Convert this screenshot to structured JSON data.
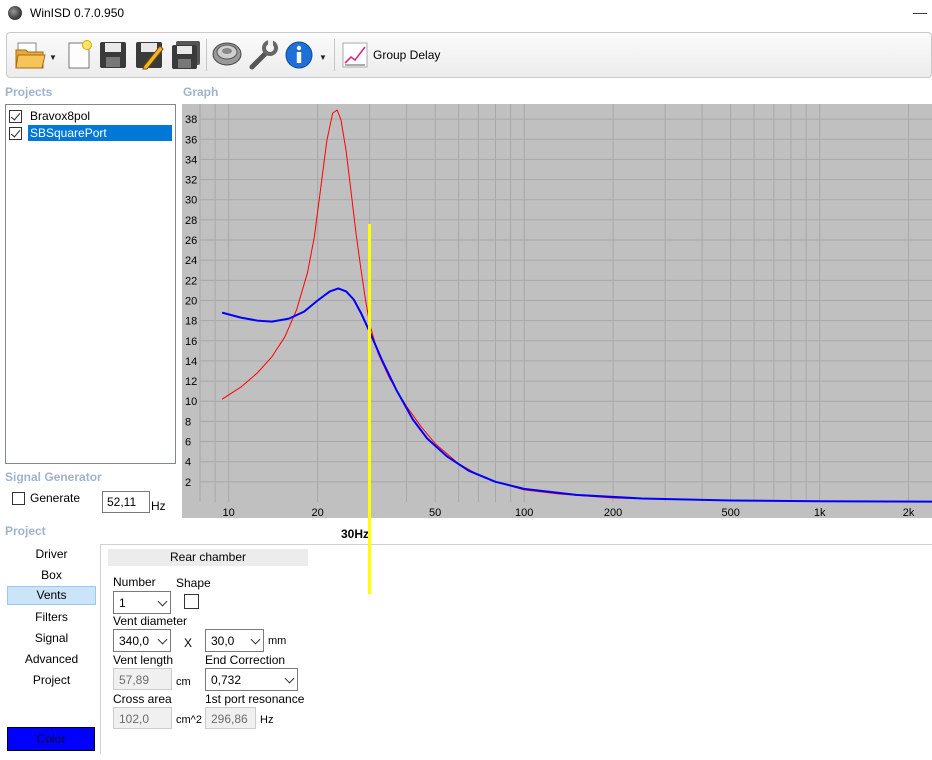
{
  "window": {
    "title": "WinISD 0.7.0.950",
    "minimize_glyph": "—"
  },
  "toolbar": {
    "icons": [
      "open-folder-icon",
      "new-document-icon",
      "save-icon",
      "edit-save-icon",
      "save-all-icon",
      "driver-icon",
      "tools-wrench-icon",
      "info-icon",
      "group-delay-chart-icon"
    ],
    "group_delay_label": "Group Delay"
  },
  "sections": {
    "projects": "Projects",
    "graph": "Graph",
    "signal_generator": "Signal Generator",
    "project": "Project"
  },
  "projects": [
    {
      "name": "Bravox8pol",
      "checked": true,
      "selected": false
    },
    {
      "name": "SBSquarePort",
      "checked": true,
      "selected": true
    }
  ],
  "graph": {
    "marker_label": "30Hz",
    "marker_color": "#ffff00",
    "background": "#c0c0c0"
  },
  "chart_data": {
    "type": "line",
    "x_scale": "log",
    "xlim": [
      8,
      2400
    ],
    "ylim": [
      0,
      39.5
    ],
    "x_ticks": [
      {
        "value": 10,
        "label": "10"
      },
      {
        "value": 20,
        "label": "20"
      },
      {
        "value": 50,
        "label": "50"
      },
      {
        "value": 100,
        "label": "100"
      },
      {
        "value": 200,
        "label": "200"
      },
      {
        "value": 500,
        "label": "500"
      },
      {
        "value": 1000,
        "label": "1k"
      },
      {
        "value": 2000,
        "label": "2k"
      }
    ],
    "y_ticks": [
      2,
      4,
      6,
      8,
      10,
      12,
      14,
      16,
      18,
      20,
      22,
      24,
      26,
      28,
      30,
      32,
      34,
      36,
      38
    ],
    "grid": true,
    "marker_x": 30,
    "series": [
      {
        "color": "#ff0000",
        "width": 1,
        "points": [
          [
            9.5,
            10.2
          ],
          [
            11,
            11.4
          ],
          [
            12.5,
            12.8
          ],
          [
            14,
            14.4
          ],
          [
            15.5,
            16.4
          ],
          [
            17,
            19.1
          ],
          [
            18.5,
            22.8
          ],
          [
            19.5,
            26.3
          ],
          [
            20.5,
            31.2
          ],
          [
            21.5,
            35.9
          ],
          [
            22.5,
            38.6
          ],
          [
            23.3,
            38.9
          ],
          [
            24,
            37.9
          ],
          [
            25,
            34.8
          ],
          [
            26,
            30.6
          ],
          [
            27,
            26.6
          ],
          [
            28,
            23.2
          ],
          [
            29,
            20.2
          ],
          [
            30,
            17.7
          ],
          [
            32,
            14.8
          ],
          [
            35,
            12.3
          ],
          [
            40,
            9.5
          ],
          [
            45,
            7.4
          ],
          [
            50,
            5.8
          ],
          [
            60,
            3.8
          ],
          [
            70,
            2.7
          ],
          [
            80,
            2.0
          ],
          [
            100,
            1.2
          ],
          [
            130,
            0.8
          ],
          [
            200,
            0.4
          ],
          [
            400,
            0.2
          ],
          [
            800,
            0.1
          ],
          [
            2400,
            0.05
          ]
        ]
      },
      {
        "color": "#0000ff",
        "width": 2,
        "points": [
          [
            9.5,
            18.8
          ],
          [
            11,
            18.3
          ],
          [
            12.5,
            18.0
          ],
          [
            14,
            17.9
          ],
          [
            16,
            18.2
          ],
          [
            18,
            18.9
          ],
          [
            20,
            20.0
          ],
          [
            22,
            20.9
          ],
          [
            23.5,
            21.2
          ],
          [
            25,
            20.9
          ],
          [
            26.5,
            20.1
          ],
          [
            28,
            18.8
          ],
          [
            30,
            16.9
          ],
          [
            33,
            14.1
          ],
          [
            37,
            11.1
          ],
          [
            42,
            8.2
          ],
          [
            47,
            6.3
          ],
          [
            55,
            4.5
          ],
          [
            65,
            3.1
          ],
          [
            80,
            2.0
          ],
          [
            100,
            1.3
          ],
          [
            150,
            0.7
          ],
          [
            250,
            0.35
          ],
          [
            500,
            0.15
          ],
          [
            1000,
            0.08
          ],
          [
            2400,
            0.04
          ]
        ]
      }
    ]
  },
  "signal_generator": {
    "generate_label": "Generate",
    "generate_checked": false,
    "frequency": "52,11",
    "unit": "Hz"
  },
  "nav": [
    {
      "label": "Driver",
      "active": false
    },
    {
      "label": "Box",
      "active": false
    },
    {
      "label": "Vents",
      "active": true
    },
    {
      "label": "Filters",
      "active": false
    },
    {
      "label": "Signal",
      "active": false
    },
    {
      "label": "Advanced",
      "active": false
    },
    {
      "label": "Project",
      "active": false
    }
  ],
  "color_button": {
    "label": "Color",
    "color": "#0000ff"
  },
  "vents": {
    "header": "Rear chamber",
    "number_label": "Number",
    "number_value": "1",
    "shape_label": "Shape",
    "vent_diameter_label": "Vent diameter",
    "width_value": "340,0",
    "x_label": "X",
    "height_value": "30,0",
    "mm_unit": "mm",
    "vent_length_label": "Vent length",
    "vent_length_value": "57,89",
    "cm_unit": "cm",
    "end_correction_label": "End Correction",
    "end_correction_value": "0,732",
    "cross_area_label": "Cross area",
    "cross_area_value": "102,0",
    "cm2_unit": "cm^2",
    "first_port_label": "1st port resonance",
    "first_port_value": "296,86",
    "hz_unit": "Hz"
  }
}
